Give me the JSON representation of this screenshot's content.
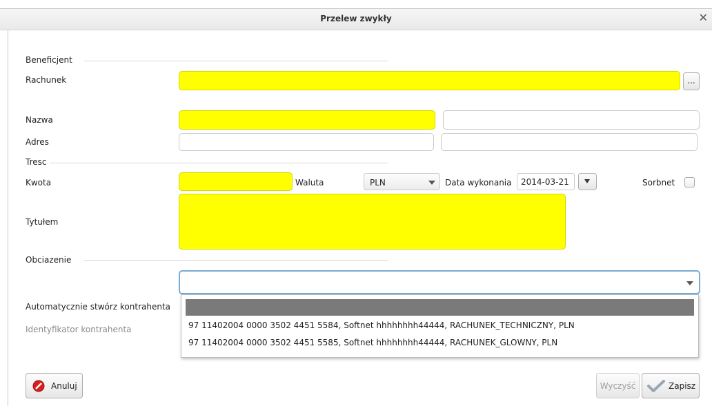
{
  "window": {
    "title": "Przelew zwykły",
    "close_glyph": "✕"
  },
  "beneficjent": {
    "section": "Beneficjent",
    "rachunek_label": "Rachunek",
    "rachunek_value": "",
    "browse_label": "...",
    "nazwa_label": "Nazwa",
    "nazwa_value": "",
    "nazwa_value2": "",
    "adres_label": "Adres",
    "adres_value": "",
    "adres_value2": ""
  },
  "tresc": {
    "section": "Tresc",
    "kwota_label": "Kwota",
    "kwota_value": "",
    "waluta_label": "Waluta",
    "waluta_value": "PLN",
    "data_label": "Data wykonania",
    "data_value": "2014-03-21",
    "sorbnet_label": "Sorbnet",
    "sorbnet_checked": false,
    "tytulem_label": "Tytułem",
    "tytulem_value": ""
  },
  "obciazenie": {
    "section": "Obciazenie",
    "account_value": "",
    "options": [
      "",
      "97 11402004 0000 3502 4451 5584, Softnet hhhhhhhh44444, RACHUNEK_TECHNICZNY, PLN",
      "97 11402004 0000 3502 4451 5585, Softnet hhhhhhhh44444, RACHUNEK_GLOWNY, PLN"
    ]
  },
  "kontrahent": {
    "auto_label": "Automatycznie stwórz kontrahenta",
    "id_label": "Identyfikator kontrahenta"
  },
  "footer": {
    "cancel_label": "Anuluj",
    "clear_label": "Wyczyść",
    "save_label": "Zapisz"
  },
  "colors": {
    "required_field": "#ffff00",
    "focus_border": "#7aaad6",
    "cancel_icon": "#d81e1e",
    "save_icon": "#9aa7b3"
  },
  "icons": {
    "cancel": "cancel-icon",
    "save": "check-icon",
    "dropdown": "chevron-down-icon"
  }
}
